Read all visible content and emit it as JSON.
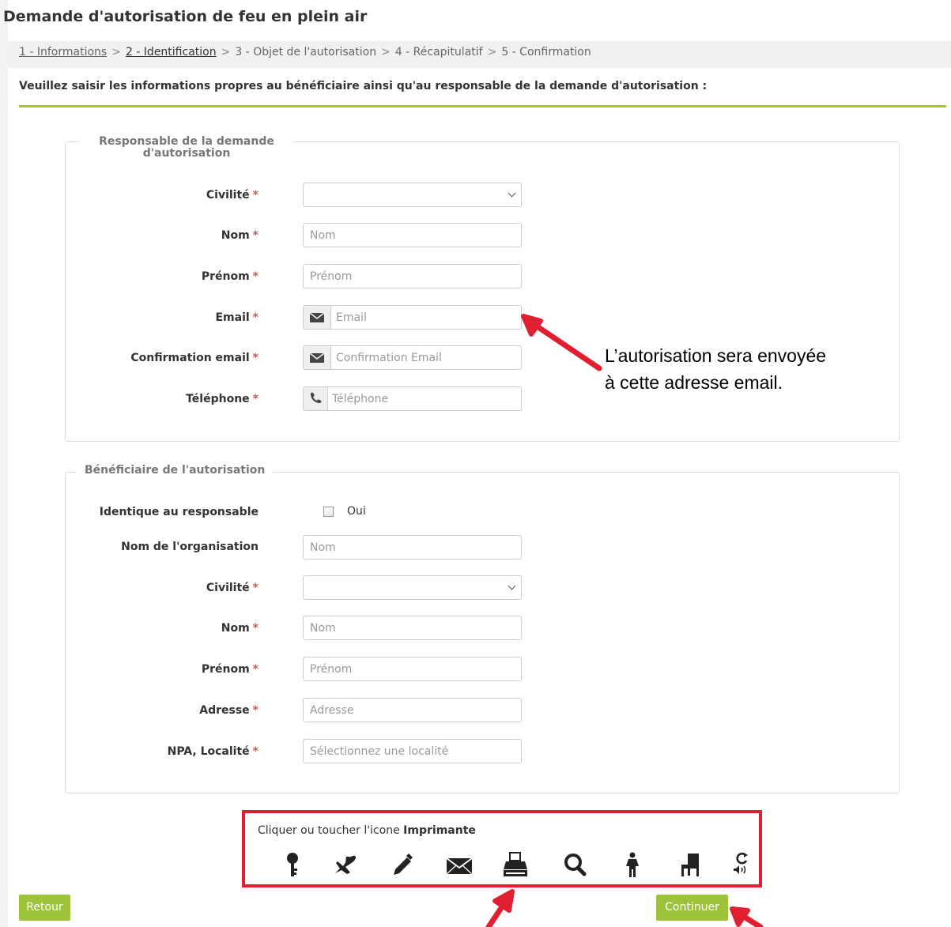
{
  "page": {
    "title": "Demande d'autorisation de feu en plein air",
    "instructions": "Veuillez saisir les informations propres au bénéficiaire ainsi qu'au responsable de la demande d'autorisation :"
  },
  "breadcrumb": {
    "steps": [
      "1 - Informations",
      "2 - Identification",
      "3 - Objet de l'autorisation",
      "4 - Récapitulatif",
      "5 - Confirmation"
    ],
    "separator": ">"
  },
  "responsable": {
    "legend": "Responsable de la demande d'autorisation",
    "legend_line1": "Responsable de la demande",
    "legend_line2": "d'autorisation",
    "civilite_label": "Civilité",
    "nom_label": "Nom",
    "nom_placeholder": "Nom",
    "prenom_label": "Prénom",
    "prenom_placeholder": "Prénom",
    "email_label": "Email",
    "email_placeholder": "Email",
    "confirm_label": "Confirmation email",
    "confirm_placeholder": "Confirmation Email",
    "tel_label": "Téléphone",
    "tel_placeholder": "Téléphone",
    "required_mark": "*"
  },
  "beneficiaire": {
    "legend": "Bénéficiaire de l'autorisation",
    "identique_label": "Identique au responsable",
    "identique_option": "Oui",
    "identique_checked": false,
    "organisation_label": "Nom de l'organisation",
    "organisation_placeholder": "Nom",
    "civilite_label": "Civilité",
    "nom_label": "Nom",
    "nom_placeholder": "Nom",
    "prenom_label": "Prénom",
    "prenom_placeholder": "Prénom",
    "adresse_label": "Adresse",
    "adresse_placeholder": "Adresse",
    "npa_label": "NPA, Localité",
    "npa_placeholder": "Sélectionnez une localité"
  },
  "annotation": {
    "line1": "L’autorisation sera envoyée",
    "line2": "à cette adresse email."
  },
  "captcha": {
    "hint_prefix": "Cliquer ou toucher l'icone ",
    "hint_target": "Imprimante",
    "icons": [
      "key-icon",
      "airplane-icon",
      "pencil-icon",
      "envelope-icon",
      "printer-icon",
      "search-icon",
      "person-icon",
      "chair-icon",
      "refresh-audio-icon"
    ]
  },
  "buttons": {
    "back": "Retour",
    "continue": "Continuer"
  },
  "colors": {
    "accent_green": "#9cc33b",
    "annotation_red": "#e02030",
    "required_red": "#d9534f"
  }
}
